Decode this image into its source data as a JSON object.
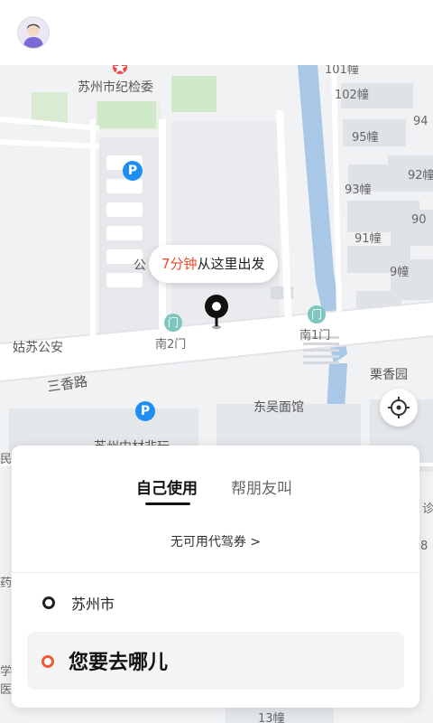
{
  "header": {
    "avatar_icon": "user-avatar"
  },
  "map": {
    "labels": {
      "commission": "苏州市纪检委",
      "b102": "102幢",
      "b95": "95幢",
      "b94": "94",
      "b93": "93幢",
      "b92": "92幢",
      "b91": "91幢",
      "b90": "90",
      "b9": "9幢",
      "gong": "公",
      "south2": "南2门",
      "south1": "南1门",
      "police": "姑苏公安",
      "road": "三香路",
      "lixiang": "栗香园",
      "dongwu": "东吴面馆",
      "suzhou_middle": "苏州中材非玩",
      "b13": "13幢",
      "edge_min": "民",
      "edge_zhen": "诊",
      "edge_ba": "8",
      "edge_yao": "药",
      "edge_xue": "学",
      "edge_yi": "医",
      "edge_top": "101幢"
    },
    "parking_label": "P",
    "gate_label": "门",
    "bubble": {
      "time": "7分钟",
      "text": "从这里出发"
    },
    "accent_color": "#ee4b2b"
  },
  "panel": {
    "tabs": [
      {
        "label": "自己使用",
        "active": true
      },
      {
        "label": "帮朋友叫",
        "active": false
      }
    ],
    "coupon": "无可用代驾券 >",
    "origin": "苏州市",
    "destination_placeholder": "您要去哪儿"
  }
}
